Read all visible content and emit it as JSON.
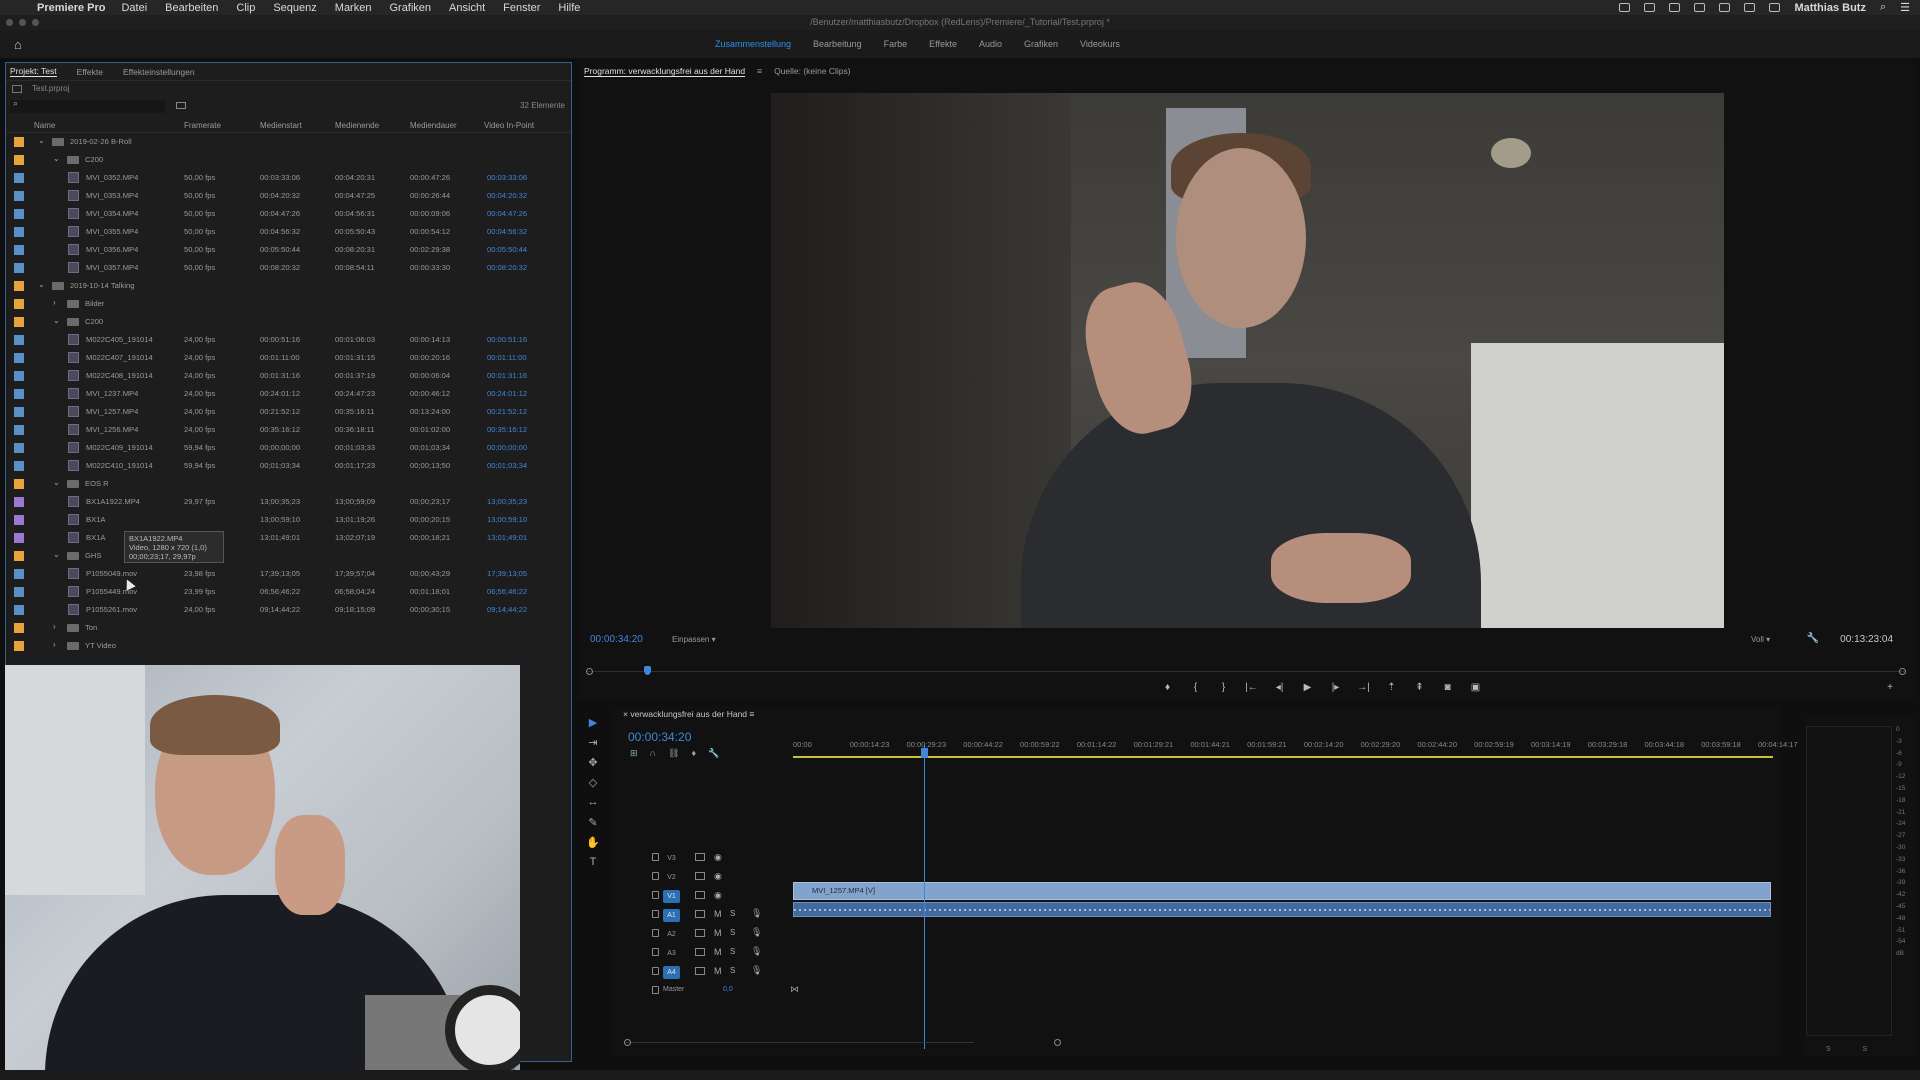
{
  "menubar": {
    "app": "Premiere Pro",
    "items": [
      "Datei",
      "Bearbeiten",
      "Clip",
      "Sequenz",
      "Marken",
      "Grafiken",
      "Ansicht",
      "Fenster",
      "Hilfe"
    ],
    "user": "Matthias Butz"
  },
  "titlebar": {
    "path": "/Benutzer/matthiasbutz/Dropbox (RedLens)/Premiere/_Tutorial/Test.prproj *"
  },
  "workspaces": {
    "tabs": [
      "Zusammenstellung",
      "Bearbeitung",
      "Farbe",
      "Effekte",
      "Audio",
      "Grafiken",
      "Videokurs"
    ],
    "active": "Zusammenstellung"
  },
  "project": {
    "tabs": [
      "Projekt: Test",
      "Effekte",
      "Effekteinstellungen"
    ],
    "file": "Test.prproj",
    "count": "32 Elemente",
    "columns": [
      "Name",
      "Framerate",
      "Medienstart",
      "Medienende",
      "Mediendauer",
      "Video In-Point"
    ],
    "rows": [
      {
        "level": 0,
        "type": "bin",
        "open": true,
        "name": "2019-02-26 B-Roll",
        "color": "#e8a33a"
      },
      {
        "level": 1,
        "type": "bin",
        "open": true,
        "name": "C200",
        "color": "#e8a33a"
      },
      {
        "level": 2,
        "type": "clip",
        "name": "MVI_0352.MP4",
        "fps": "50,00 fps",
        "start": "00:03:33:06",
        "end": "00:04:20:31",
        "dur": "00:00:47:26",
        "in": "00:03:33:06",
        "color": "#5b8fc7"
      },
      {
        "level": 2,
        "type": "clip",
        "name": "MVI_0353.MP4",
        "fps": "50,00 fps",
        "start": "00:04:20:32",
        "end": "00:04:47:25",
        "dur": "00:00:26:44",
        "in": "00:04:20:32",
        "color": "#5b8fc7"
      },
      {
        "level": 2,
        "type": "clip",
        "name": "MVI_0354.MP4",
        "fps": "50,00 fps",
        "start": "00:04:47:26",
        "end": "00:04:56:31",
        "dur": "00:00:09:06",
        "in": "00:04:47:26",
        "color": "#5b8fc7"
      },
      {
        "level": 2,
        "type": "clip",
        "name": "MVI_0355.MP4",
        "fps": "50,00 fps",
        "start": "00:04:56:32",
        "end": "00:05:50:43",
        "dur": "00:00:54:12",
        "in": "00:04:56:32",
        "color": "#5b8fc7"
      },
      {
        "level": 2,
        "type": "clip",
        "name": "MVI_0356.MP4",
        "fps": "50,00 fps",
        "start": "00:05:50:44",
        "end": "00:08:20:31",
        "dur": "00:02:29:38",
        "in": "00:05:50:44",
        "color": "#5b8fc7"
      },
      {
        "level": 2,
        "type": "clip",
        "name": "MVI_0357.MP4",
        "fps": "50,00 fps",
        "start": "00:08:20:32",
        "end": "00:08:54:11",
        "dur": "00:00:33:30",
        "in": "00:08:20:32",
        "color": "#5b8fc7"
      },
      {
        "level": 0,
        "type": "bin",
        "open": true,
        "name": "2019-10-14 Talking",
        "color": "#e8a33a"
      },
      {
        "level": 1,
        "type": "bin",
        "open": false,
        "name": "Bilder",
        "color": "#e8a33a"
      },
      {
        "level": 1,
        "type": "bin",
        "open": true,
        "name": "C200",
        "color": "#e8a33a"
      },
      {
        "level": 2,
        "type": "clip",
        "name": "M022C405_191014",
        "fps": "24,00 fps",
        "start": "00:00:51:16",
        "end": "00:01:06:03",
        "dur": "00:00:14:13",
        "in": "00:00:51:16",
        "color": "#5b8fc7"
      },
      {
        "level": 2,
        "type": "clip",
        "name": "M022C407_191014",
        "fps": "24,00 fps",
        "start": "00:01:11:00",
        "end": "00:01:31:15",
        "dur": "00:00:20:16",
        "in": "00:01:11:00",
        "color": "#5b8fc7"
      },
      {
        "level": 2,
        "type": "clip",
        "name": "M022C408_191014",
        "fps": "24,00 fps",
        "start": "00:01:31:16",
        "end": "00:01:37:19",
        "dur": "00:00:06:04",
        "in": "00:01:31:16",
        "color": "#5b8fc7"
      },
      {
        "level": 2,
        "type": "clip",
        "name": "MVI_1237.MP4",
        "fps": "24,00 fps",
        "start": "00:24:01:12",
        "end": "00:24:47:23",
        "dur": "00:00:46:12",
        "in": "00:24:01:12",
        "color": "#5b8fc7"
      },
      {
        "level": 2,
        "type": "clip",
        "name": "MVI_1257.MP4",
        "fps": "24,00 fps",
        "start": "00:21:52:12",
        "end": "00:35:16:11",
        "dur": "00:13:24:00",
        "in": "00:21:52:12",
        "color": "#5b8fc7"
      },
      {
        "level": 2,
        "type": "clip",
        "name": "MVI_1256.MP4",
        "fps": "24,00 fps",
        "start": "00:35:16:12",
        "end": "00:36:18:11",
        "dur": "00:01:02:00",
        "in": "00:35:16:12",
        "color": "#5b8fc7"
      },
      {
        "level": 2,
        "type": "clip",
        "name": "M022C409_191014",
        "fps": "59,94 fps",
        "start": "00;00;00;00",
        "end": "00;01;03;33",
        "dur": "00;01;03;34",
        "in": "00;00;00;00",
        "color": "#5b8fc7"
      },
      {
        "level": 2,
        "type": "clip",
        "name": "M022C410_191014",
        "fps": "59,94 fps",
        "start": "00;01;03;34",
        "end": "00;01;17;23",
        "dur": "00;00;13;50",
        "in": "00;01;03;34",
        "color": "#5b8fc7"
      },
      {
        "level": 1,
        "type": "bin",
        "open": true,
        "name": "EOS R",
        "color": "#e8a33a"
      },
      {
        "level": 2,
        "type": "clip",
        "name": "BX1A1922.MP4",
        "fps": "29,97 fps",
        "start": "13;00;35;23",
        "end": "13;00;59;09",
        "dur": "00;00;23;17",
        "in": "13;00;35;23",
        "color": "#9a7ad1"
      },
      {
        "level": 2,
        "type": "clip",
        "name": "BX1A",
        "fps": "",
        "start": "13;00;59;10",
        "end": "13;01;19;26",
        "dur": "00;00;20;15",
        "in": "13;00;59;10",
        "color": "#9a7ad1"
      },
      {
        "level": 2,
        "type": "clip",
        "name": "BX1A",
        "fps": "",
        "start": "13;01;49;01",
        "end": "13;02;07;19",
        "dur": "00;00;18;21",
        "in": "13;01;49;01",
        "color": "#9a7ad1"
      },
      {
        "level": 1,
        "type": "bin",
        "open": true,
        "name": "GHS",
        "color": "#e8a33a"
      },
      {
        "level": 2,
        "type": "clip",
        "name": "P1055049.mov",
        "fps": "23,98 fps",
        "start": "17;39;13;05",
        "end": "17;39;57;04",
        "dur": "00;00;43;29",
        "in": "17;39;13;05",
        "color": "#5b8fc7"
      },
      {
        "level": 2,
        "type": "clip",
        "name": "P1055449.mov",
        "fps": "23,99 fps",
        "start": "06;56;46;22",
        "end": "06;58;04;24",
        "dur": "00;01;18;01",
        "in": "06;56;46;22",
        "color": "#5b8fc7"
      },
      {
        "level": 2,
        "type": "clip",
        "name": "P1055261.mov",
        "fps": "24,00 fps",
        "start": "09;14;44;22",
        "end": "09;18;15;09",
        "dur": "00;00;30;15",
        "in": "09;14;44;22",
        "color": "#5b8fc7"
      },
      {
        "level": 1,
        "type": "bin",
        "open": false,
        "name": "Ton",
        "color": "#e8a33a"
      },
      {
        "level": 1,
        "type": "bin",
        "open": false,
        "name": "YT Video",
        "color": "#e8a33a"
      }
    ],
    "tooltip": [
      "BX1A1922.MP4",
      "Video, 1280 x 720 (1,0)",
      "00;00;23;17, 29,97p"
    ]
  },
  "program": {
    "tabs": [
      "Programm: verwacklungsfrei aus der Hand",
      "Quelle: (keine Clips)"
    ],
    "timecode": "00:00:34:20",
    "fit": "Einpassen",
    "quality": "Voll",
    "duration": "00:13:23:04",
    "transport": [
      "marker",
      "in",
      "out",
      "goto-in",
      "step-back",
      "play",
      "step-forward",
      "goto-out",
      "lift",
      "extract",
      "export-frame",
      "compare"
    ]
  },
  "timeline": {
    "sequence": "verwacklungsfrei aus der Hand",
    "timecode": "00:00:34:20",
    "ruler": [
      "00:00",
      "00:00:14:23",
      "00:00:29:23",
      "00:00:44:22",
      "00:00:59:22",
      "00:01:14:22",
      "00:01:29:21",
      "00:01:44:21",
      "00:01:59:21",
      "00:02:14:20",
      "00:02:29:20",
      "00:02:44:20",
      "00:02:59:19",
      "00:03:14:19",
      "00:03:29:18",
      "00:03:44:18",
      "00:03:59:18",
      "00:04:14:17"
    ],
    "video_tracks": [
      "V3",
      "V2",
      "V1"
    ],
    "audio_tracks": [
      "A1",
      "A2",
      "A3",
      "A4"
    ],
    "master_label": "Master",
    "master_value": "0,0",
    "clip_name": "MVI_1257.MP4 [V]",
    "playhead_fraction": 0.133
  },
  "meters": {
    "scale": [
      "0",
      "-3",
      "-6",
      "-9",
      "-12",
      "-15",
      "-18",
      "-21",
      "-24",
      "-27",
      "-30",
      "-33",
      "-36",
      "-39",
      "-42",
      "-45",
      "-48",
      "-51",
      "-54",
      "dB"
    ],
    "footer": "S S"
  },
  "colors": {
    "accent": "#3f87d9",
    "bin": "#e8a33a",
    "clip": "#5b8fc7",
    "mp4_eos": "#9a7ad1"
  }
}
